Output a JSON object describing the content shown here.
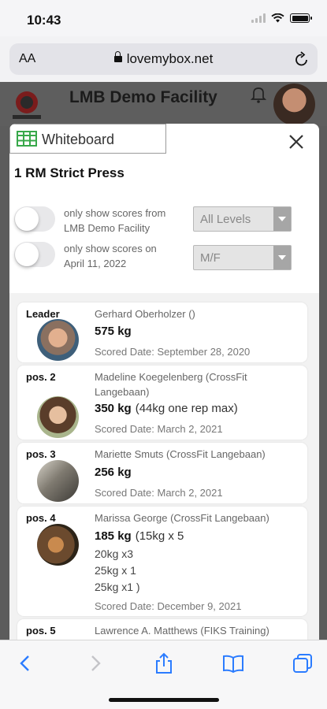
{
  "status_bar": {
    "time": "10:43"
  },
  "browser": {
    "aa_label": "AA",
    "url": "lovemybox.net"
  },
  "site": {
    "title": "LMB Demo Facility"
  },
  "modal": {
    "tab_label": "Whiteboard",
    "workout_title": "1 RM Strict Press",
    "filters": [
      {
        "line1": "only show scores from",
        "line2": "LMB Demo Facility",
        "enabled": false
      },
      {
        "line1": "only show scores on",
        "line2": "April 11, 2022",
        "enabled": false
      }
    ],
    "level_select": {
      "value": "All Levels"
    },
    "gender_select": {
      "value": "M/F"
    }
  },
  "leaderboard": [
    {
      "position": "Leader",
      "name": "Gerhard Oberholzer ()",
      "score": "575 kg",
      "date": "Scored Date: September 28, 2020"
    },
    {
      "position": "pos. 2",
      "name": "Madeline Koegelenberg (CrossFit Langebaan)",
      "score": "350 kg",
      "note": "(44kg one rep max)",
      "date": "Scored Date: March 2, 2021"
    },
    {
      "position": "pos. 3",
      "name": "Mariette Smuts (CrossFit Langebaan)",
      "score": "256 kg",
      "date": "Scored Date: March 2, 2021"
    },
    {
      "position": "pos. 4",
      "name": "Marissa George (CrossFit Langebaan)",
      "score": "185 kg",
      "note": "(15kg x 5",
      "extra": [
        "20kg x3",
        "25kg x 1",
        "25kg x1 )"
      ],
      "date": "Scored Date: December 9, 2021"
    },
    {
      "position": "pos. 5",
      "name": "Lawrence A. Matthews  (FIKS Training)"
    }
  ],
  "icons": {
    "wifi": "wifi-icon",
    "battery": "battery-icon",
    "lock": "lock-icon",
    "reload": "reload-icon",
    "bell": "bell-icon",
    "grid": "spreadsheet-icon",
    "close": "close-icon",
    "back": "back-chevron-icon",
    "forward": "forward-chevron-icon",
    "share": "share-icon",
    "bookmarks": "book-icon",
    "tabs": "tabs-icon"
  },
  "colors": {
    "accent": "#2b7cff",
    "grid_icon": "#38a84a",
    "site_bg": "#5c5c5c"
  }
}
